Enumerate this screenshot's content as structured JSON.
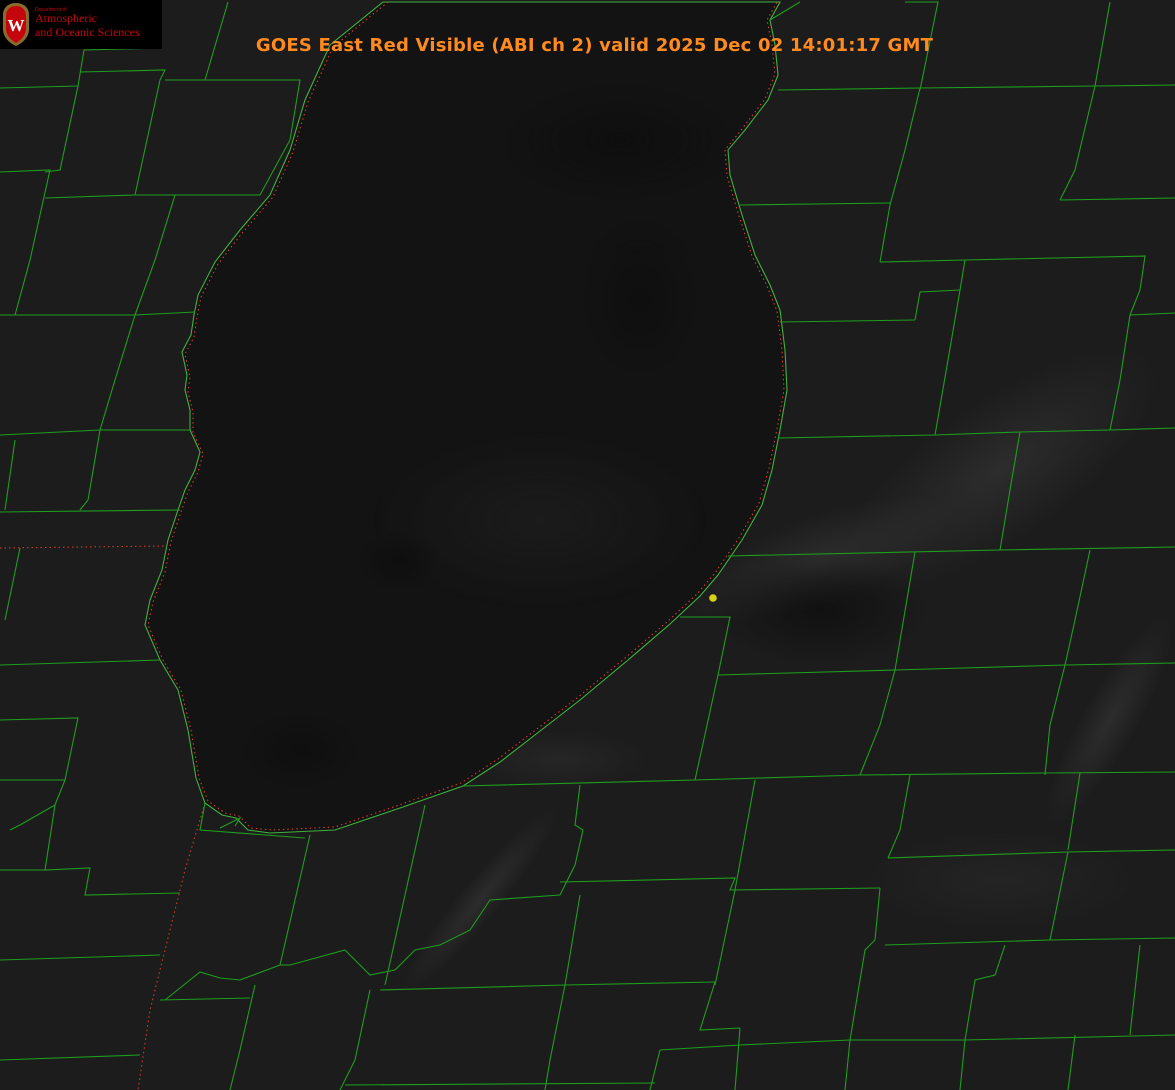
{
  "header": {
    "title": "GOES East Red Visible (ABI ch 2) valid 2025 Dec 02 14:01:17 GMT"
  },
  "logo": {
    "seal_letter": "W",
    "department": "Department of",
    "line1": "Atmospheric",
    "line2": "and Oceanic Sciences"
  },
  "map": {
    "product": "GOES East Red Visible (ABI ch 2)",
    "lake_shoreline_color": "#3fb23f",
    "county_border_color": "#1e9e1e",
    "state_border_color": "#cc3b2a",
    "station_marker_color": "#d6d214",
    "lake_fill_color": "#131313",
    "land_fill_color": "#1c1c1c"
  }
}
